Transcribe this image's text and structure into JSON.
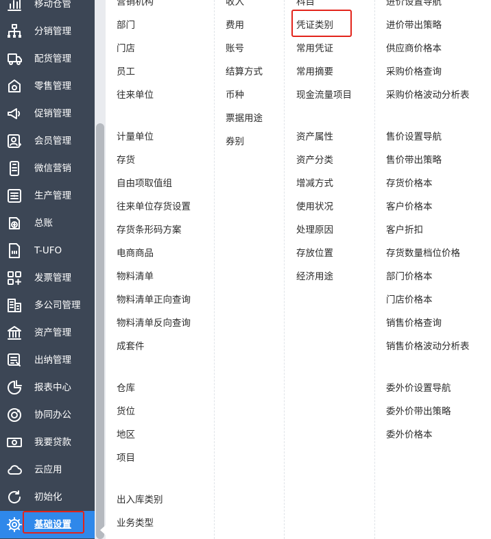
{
  "sidebar": {
    "items": [
      {
        "label": "移动仓管",
        "icon": "chart-bar-icon"
      },
      {
        "label": "分销管理",
        "icon": "org-chart-icon"
      },
      {
        "label": "配货管理",
        "icon": "truck-icon"
      },
      {
        "label": "零售管理",
        "icon": "shop-icon"
      },
      {
        "label": "促销管理",
        "icon": "megaphone-icon"
      },
      {
        "label": "会员管理",
        "icon": "member-card-icon"
      },
      {
        "label": "微信营销",
        "icon": "phone-icon"
      },
      {
        "label": "生产管理",
        "icon": "production-icon"
      },
      {
        "label": "总账",
        "icon": "ledger-icon"
      },
      {
        "label": "T-UFO",
        "icon": "ufo-file-icon"
      },
      {
        "label": "发票管理",
        "icon": "invoice-grid-icon"
      },
      {
        "label": "多公司管理",
        "icon": "building-icon"
      },
      {
        "label": "资产管理",
        "icon": "bank-icon"
      },
      {
        "label": "出纳管理",
        "icon": "cashier-icon"
      },
      {
        "label": "报表中心",
        "icon": "pie-chart-icon"
      },
      {
        "label": "协同办公",
        "icon": "collaboration-icon"
      },
      {
        "label": "我要贷款",
        "icon": "money-icon"
      },
      {
        "label": "云应用",
        "icon": "cloud-icon"
      },
      {
        "label": "初始化",
        "icon": "refresh-icon"
      },
      {
        "label": "基础设置",
        "icon": "settings-gear-icon",
        "active": true
      }
    ]
  },
  "menu": {
    "col1": {
      "g1": [
        "营销机构",
        "部门",
        "门店",
        "员工",
        "往来单位"
      ],
      "g2": [
        "计量单位",
        "存货",
        "自由项取值组",
        "往来单位存货设置",
        "存货条形码方案",
        "电商商品",
        "物料清单",
        "物料清单正向查询",
        "物料清单反向查询",
        "成套件"
      ],
      "g3": [
        "仓库",
        "货位",
        "地区",
        "项目"
      ],
      "g4": [
        "出入库类别",
        "业务类型"
      ]
    },
    "col2": {
      "g1": [
        "收入",
        "费用",
        "账号",
        "结算方式",
        "币种",
        "票据用途",
        "券别"
      ]
    },
    "col3": {
      "g1": [
        "科目",
        "凭证类别",
        "常用凭证",
        "常用摘要",
        "现金流量项目"
      ],
      "g2": [
        "资产属性",
        "资产分类",
        "增减方式",
        "使用状况",
        "处理原因",
        "存放位置",
        "经济用途"
      ]
    },
    "col4": {
      "g1": [
        "进价设置导航",
        "进价带出策略",
        "供应商价格本",
        "采购价格查询",
        "采购价格波动分析表"
      ],
      "g2": [
        "售价设置导航",
        "售价带出策略",
        "存货价格本",
        "客户价格本",
        "客户折扣",
        "存货数量档位价格",
        "部门价格本",
        "门店价格本",
        "销售价格查询",
        "销售价格波动分析表"
      ],
      "g3": [
        "委外价设置导航",
        "委外价带出策略",
        "委外价格本"
      ]
    }
  },
  "colors": {
    "sidebar_bg": "#3c4655",
    "active_bg": "#2f88ea",
    "highlight": "#e2231a"
  }
}
